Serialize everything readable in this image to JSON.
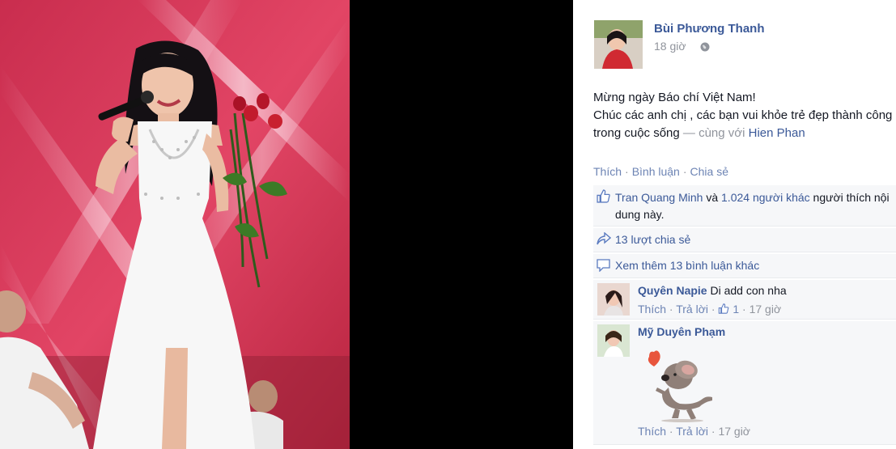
{
  "post": {
    "author": "Bùi Phương Thanh",
    "time": "18 giờ",
    "text_line1": "Mừng ngày Báo chí Việt Nam!",
    "text_line2": "Chúc các anh chị , các bạn vui khỏe trẻ đẹp thành công trong cuộc sống",
    "with_prefix": "— cùng với",
    "tagged": "Hien Phan"
  },
  "actions": {
    "like": "Thích",
    "comment": "Bình luận",
    "share": "Chia sẻ",
    "separator": "·"
  },
  "likes": {
    "first_liker": "Tran Quang Minh",
    "and": "và",
    "others": "1.024 người khác",
    "suffix": "người thích nội dung này."
  },
  "shares": {
    "label": "13 lượt chia sẻ"
  },
  "more_comments": {
    "label": "Xem thêm 13 bình luận khác"
  },
  "comments": [
    {
      "name": "Quyên Napie",
      "text": "Di add con nha",
      "like": "Thích",
      "reply": "Trả lời",
      "like_count": "1",
      "time": "17 giờ"
    },
    {
      "name": "Mỹ Duyên Phạm",
      "text": "",
      "like": "Thích",
      "reply": "Trả lời",
      "time": "17 giờ",
      "sticker": "koala-heart-sticker"
    }
  ],
  "icons": {
    "globe": "globe-icon",
    "like": "thumbs-up-icon",
    "share": "share-arrow-icon",
    "comment": "comment-bubble-icon"
  },
  "colors": {
    "link": "#3b5998",
    "muted": "#90949c",
    "action": "#6d84b4",
    "stage_pink": "#d7365a"
  }
}
